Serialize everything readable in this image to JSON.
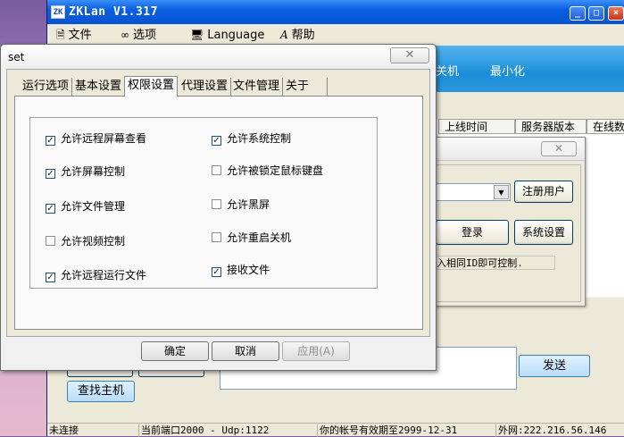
{
  "main_window": {
    "title": "ZKLan V1.317",
    "icon_text": "ZK",
    "title_buttons": {
      "minimize": "_",
      "maximize": "□",
      "close": "×"
    },
    "menu": [
      {
        "label": "文件",
        "icon": "file-icon",
        "glyph": "🗎"
      },
      {
        "label": "选项",
        "icon": "glasses-icon",
        "glyph": "∞"
      },
      {
        "label": "Language",
        "icon": "language-icon",
        "glyph": "🖥"
      },
      {
        "label": "帮助",
        "icon": "help-icon",
        "glyph": "A"
      }
    ],
    "toolbar": {
      "shutdown_label": "关机",
      "minimize_label": "最小化"
    },
    "table_headers": [
      "上线时间",
      "服务器版本",
      "在线数"
    ],
    "send_button": "发送",
    "find_host_button": "查找主机",
    "status_bar": [
      "未连接",
      "当前端口2000 - Udp:1122",
      "你的帐号有效期至2999-12-31",
      "外网:222.216.56.146"
    ]
  },
  "login_dialog": {
    "close_glyph": "✕",
    "user_select_value": "",
    "register_button": "注册用户",
    "login_button": "登录",
    "system_settings_button": "系统设置",
    "hint": "入相同ID即可控制."
  },
  "set_dialog": {
    "title": "set",
    "close_glyph": "✕",
    "tabs": [
      "运行选项",
      "基本设置",
      "权限设置",
      "代理设置",
      "文件管理",
      "关于"
    ],
    "active_tab": "权限设置",
    "permissions_left": [
      {
        "label": "允许远程屏幕查看",
        "checked": true
      },
      {
        "label": "允许屏幕控制",
        "checked": true
      },
      {
        "label": "允许文件管理",
        "checked": true
      },
      {
        "label": "允许视频控制",
        "checked": false
      },
      {
        "label": "允许远程运行文件",
        "checked": true
      }
    ],
    "permissions_right": [
      {
        "label": "允许系统控制",
        "checked": true
      },
      {
        "label": "允许被锁定鼠标键盘",
        "checked": false
      },
      {
        "label": "允许黑屏",
        "checked": false
      },
      {
        "label": "允许重启关机",
        "checked": false
      },
      {
        "label": "接收文件",
        "checked": true
      }
    ],
    "check_glyph": "✓",
    "buttons": {
      "ok": "确定",
      "cancel": "取消",
      "apply": "应用(A)"
    }
  },
  "colors": {
    "titlebar_blue": "#0553d2",
    "toolbar_blue": "#1b8ed8",
    "desktop_pink": "#e6b9cf"
  }
}
